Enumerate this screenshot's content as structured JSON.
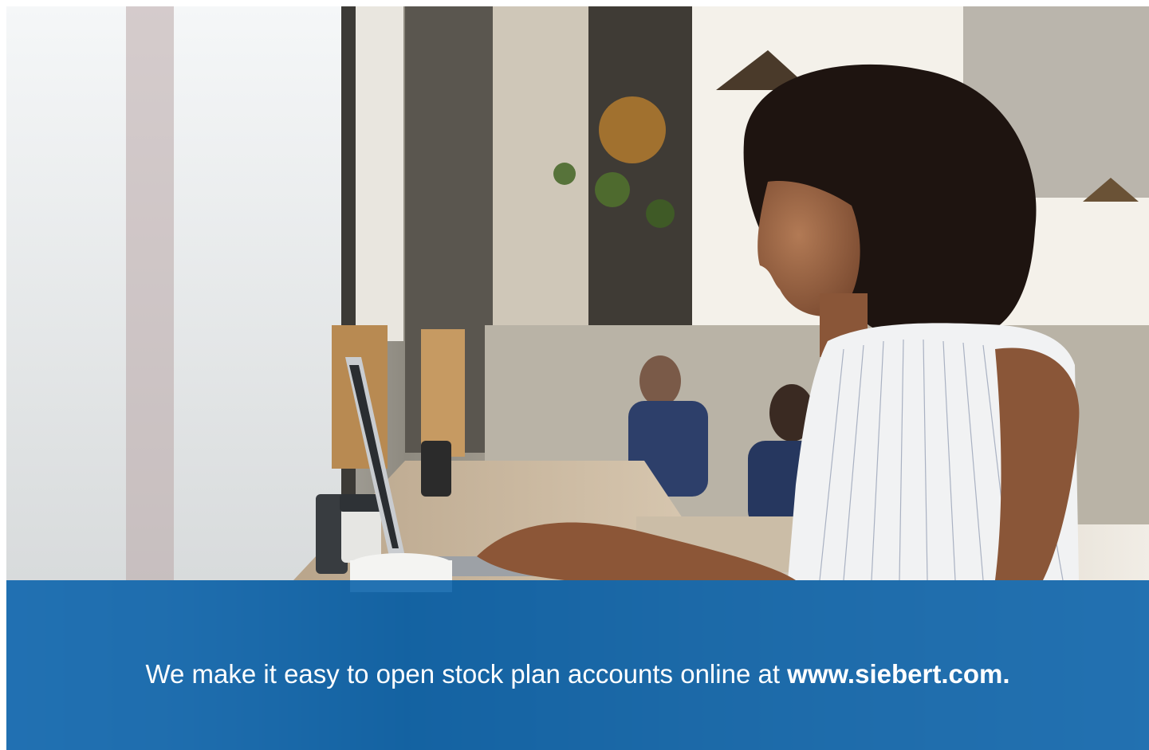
{
  "hero": {
    "photo_icon": "woman-using-laptop-in-cafe-photo",
    "banner_color": "#005ca8"
  },
  "banner": {
    "text_lead": "We make it easy to open stock plan accounts online at ",
    "text_link": "www.siebert.com."
  }
}
